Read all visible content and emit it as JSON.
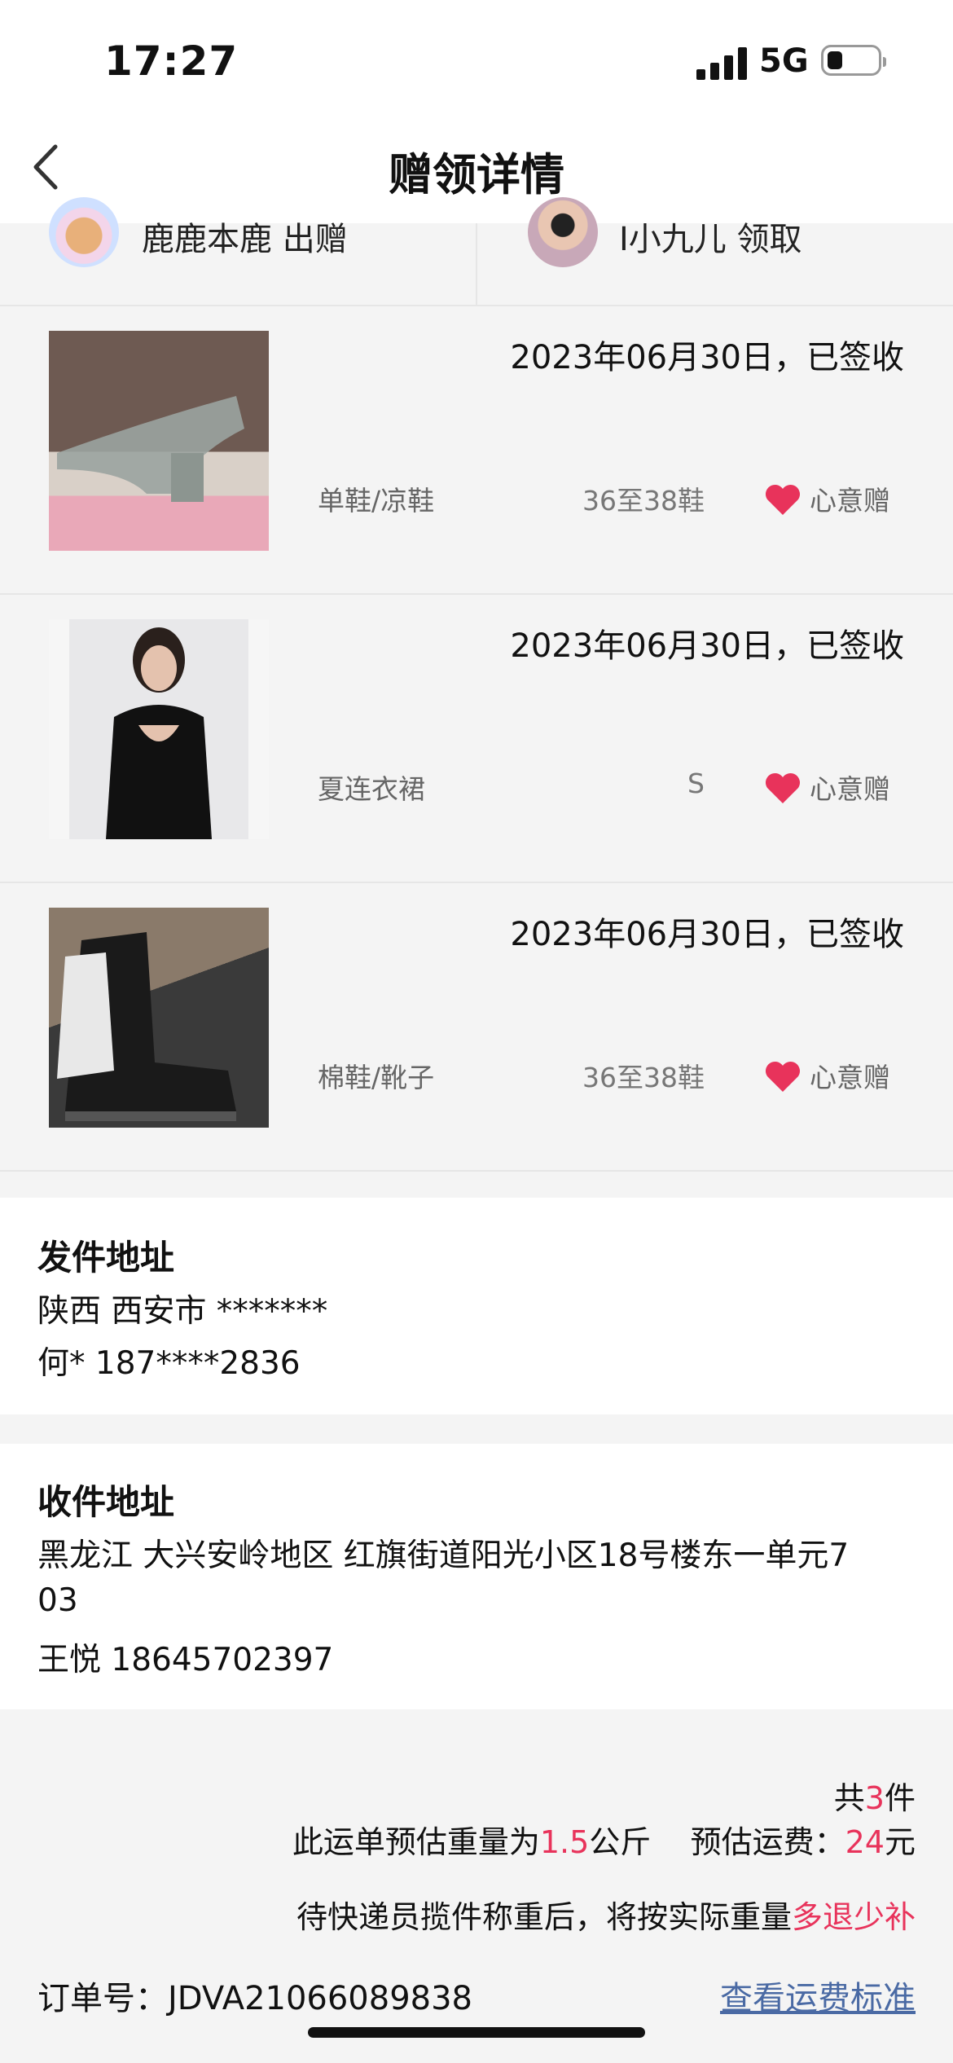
{
  "status": {
    "time": "17:27",
    "network": "5G"
  },
  "nav": {
    "title": "赠领详情"
  },
  "users": {
    "giver": {
      "name": "鹿鹿本鹿",
      "action": "出赠"
    },
    "receiver": {
      "name": "I小九儿",
      "action": "领取"
    }
  },
  "items": [
    {
      "date": "2023年06月30日，已签收",
      "category": "单鞋/凉鞋",
      "size": "36至38鞋",
      "tag": "心意赠"
    },
    {
      "date": "2023年06月30日，已签收",
      "category": "夏连衣裙",
      "size": "S",
      "tag": "心意赠"
    },
    {
      "date": "2023年06月30日，已签收",
      "category": "棉鞋/靴子",
      "size": "36至38鞋",
      "tag": "心意赠"
    }
  ],
  "sender": {
    "title": "发件地址",
    "address": "陕西 西安市 *******",
    "contact": "何* 187****2836"
  },
  "receiver_addr": {
    "title": "收件地址",
    "address_line1": "黑龙江 大兴安岭地区 红旗街道阳光小区18号楼东一单元7",
    "address_line2": "03",
    "contact": "王悦 18645702397"
  },
  "summary": {
    "count_prefix": "共",
    "count": "3",
    "count_suffix": "件",
    "weight_prefix": "此运单预估重量为",
    "weight": "1.5",
    "weight_unit": "公斤",
    "fee_prefix": "预估运费：",
    "fee": "24",
    "fee_unit": "元",
    "note_prefix": "待快递员揽件称重后，将按实际重量",
    "note_highlight": "多退少补"
  },
  "order": {
    "label": "订单号：",
    "number": "JDVA21066089838"
  },
  "link": {
    "label": "查看运费标准"
  },
  "colors": {
    "accent": "#e8335b",
    "link": "#4a6aa4"
  }
}
